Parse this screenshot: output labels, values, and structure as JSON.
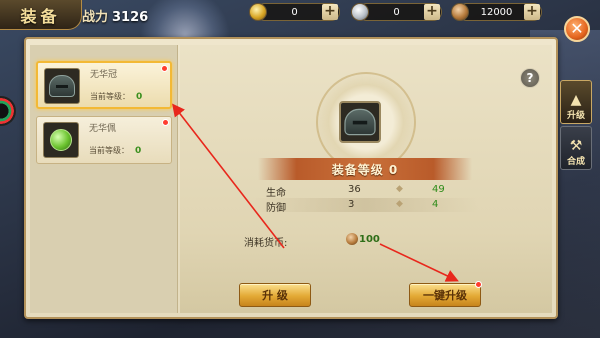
{
  "header": {
    "title": "装备",
    "power_label": "战力",
    "power_value": "3126"
  },
  "currencies": [
    {
      "icon": "gold-ingot-icon",
      "value": "0"
    },
    {
      "icon": "silver-ingot-icon",
      "value": "0"
    },
    {
      "icon": "copper-coin-icon",
      "value": "12000"
    }
  ],
  "plus_symbol": "+",
  "close_symbol": "✕",
  "equipment_list": [
    {
      "name": "无华冠",
      "level_label": "当前等级：",
      "level": "0",
      "selected": true,
      "icon": "helmet-icon"
    },
    {
      "name": "无华佩",
      "level_label": "当前等级：",
      "level": "0",
      "selected": false,
      "icon": "jade-pendant-icon"
    }
  ],
  "detail": {
    "help_symbol": "?",
    "level_banner": "装备等级 0",
    "stats": [
      {
        "name": "生命",
        "current": "36",
        "next": "49"
      },
      {
        "name": "防御",
        "current": "3",
        "next": "4"
      }
    ],
    "arrow_symbol": "◆",
    "cost_label": "消耗货币:",
    "cost_value": "100"
  },
  "buttons": {
    "upgrade": "升  级",
    "one_click_upgrade": "一键升级"
  },
  "side_tabs": [
    {
      "label": "升级",
      "glyph": "▲",
      "active": true
    },
    {
      "label": "合成",
      "glyph": "⚒",
      "active": false
    }
  ],
  "colors": {
    "accent_gold": "#e3a935",
    "banner_orange": "#c9703a",
    "stat_green": "#2e8c1a",
    "annotation_red": "#e8271c"
  }
}
